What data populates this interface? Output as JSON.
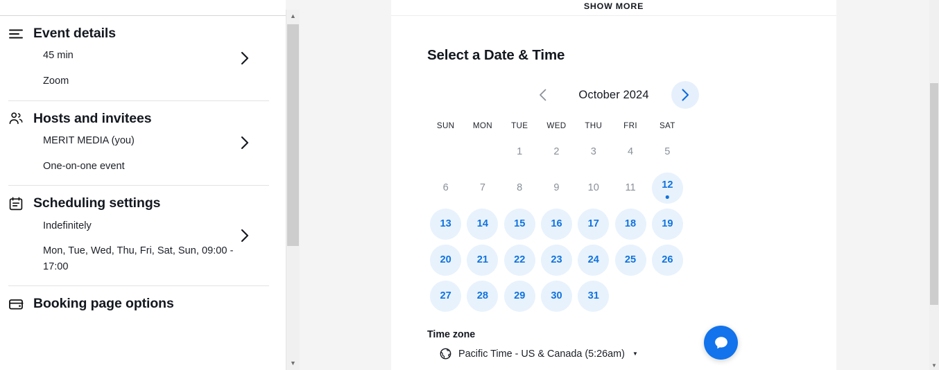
{
  "sidebar": {
    "sections": [
      {
        "icon": "list-icon",
        "title": "Event details",
        "lines": [
          "45 min",
          "Zoom"
        ],
        "chevron": "chevron-right-icon"
      },
      {
        "icon": "users-icon",
        "title": "Hosts and invitees",
        "lines": [
          "MERIT MEDIA (you)",
          "One-on-one event"
        ],
        "chevron": "chevron-right-icon"
      },
      {
        "icon": "calendar-icon",
        "title": "Scheduling settings",
        "lines": [
          "Indefinitely",
          "Mon, Tue, Wed, Thu, Fri, Sat, Sun, 09:00 - 17:00"
        ],
        "chevron": "chevron-right-icon"
      },
      {
        "icon": "card-icon",
        "title": "Booking page options",
        "lines": [],
        "chevron": "chevron-right-icon"
      }
    ]
  },
  "card": {
    "show_more": "SHOW MORE",
    "section_title": "Select a Date & Time",
    "month_label": "October 2024",
    "prev_label": "Previous month",
    "next_label": "Next month",
    "day_headers": [
      "SUN",
      "MON",
      "TUE",
      "WED",
      "THU",
      "FRI",
      "SAT"
    ],
    "weeks": [
      [
        {
          "day": "",
          "state": "empty"
        },
        {
          "day": "",
          "state": "empty"
        },
        {
          "day": "1",
          "state": "disabled"
        },
        {
          "day": "2",
          "state": "disabled"
        },
        {
          "day": "3",
          "state": "disabled"
        },
        {
          "day": "4",
          "state": "disabled"
        },
        {
          "day": "5",
          "state": "disabled"
        }
      ],
      [
        {
          "day": "6",
          "state": "disabled"
        },
        {
          "day": "7",
          "state": "disabled"
        },
        {
          "day": "8",
          "state": "disabled"
        },
        {
          "day": "9",
          "state": "disabled"
        },
        {
          "day": "10",
          "state": "disabled"
        },
        {
          "day": "11",
          "state": "disabled"
        },
        {
          "day": "12",
          "state": "today"
        }
      ],
      [
        {
          "day": "13",
          "state": "avail"
        },
        {
          "day": "14",
          "state": "avail"
        },
        {
          "day": "15",
          "state": "avail"
        },
        {
          "day": "16",
          "state": "avail"
        },
        {
          "day": "17",
          "state": "avail"
        },
        {
          "day": "18",
          "state": "avail"
        },
        {
          "day": "19",
          "state": "avail"
        }
      ],
      [
        {
          "day": "20",
          "state": "avail"
        },
        {
          "day": "21",
          "state": "avail"
        },
        {
          "day": "22",
          "state": "avail"
        },
        {
          "day": "23",
          "state": "avail"
        },
        {
          "day": "24",
          "state": "avail"
        },
        {
          "day": "25",
          "state": "avail"
        },
        {
          "day": "26",
          "state": "avail"
        }
      ],
      [
        {
          "day": "27",
          "state": "avail"
        },
        {
          "day": "28",
          "state": "avail"
        },
        {
          "day": "29",
          "state": "avail"
        },
        {
          "day": "30",
          "state": "avail"
        },
        {
          "day": "31",
          "state": "avail"
        },
        {
          "day": "",
          "state": "empty"
        },
        {
          "day": "",
          "state": "empty"
        }
      ]
    ],
    "timezone": {
      "label": "Time zone",
      "value": "Pacific Time - US & Canada (5:26am)",
      "caret": "▼"
    }
  },
  "chat": {
    "icon": "chat-bubble-icon",
    "aria": "Open chat"
  },
  "colors": {
    "accent_blue": "#1073dd",
    "chat_blue": "#1273ec",
    "day_available_bg": "#e8f2fd",
    "nav_active_bg": "#e6f0fd",
    "text_primary": "#14181f",
    "text_muted": "#8a9099",
    "page_bg": "#f4f4f4"
  }
}
